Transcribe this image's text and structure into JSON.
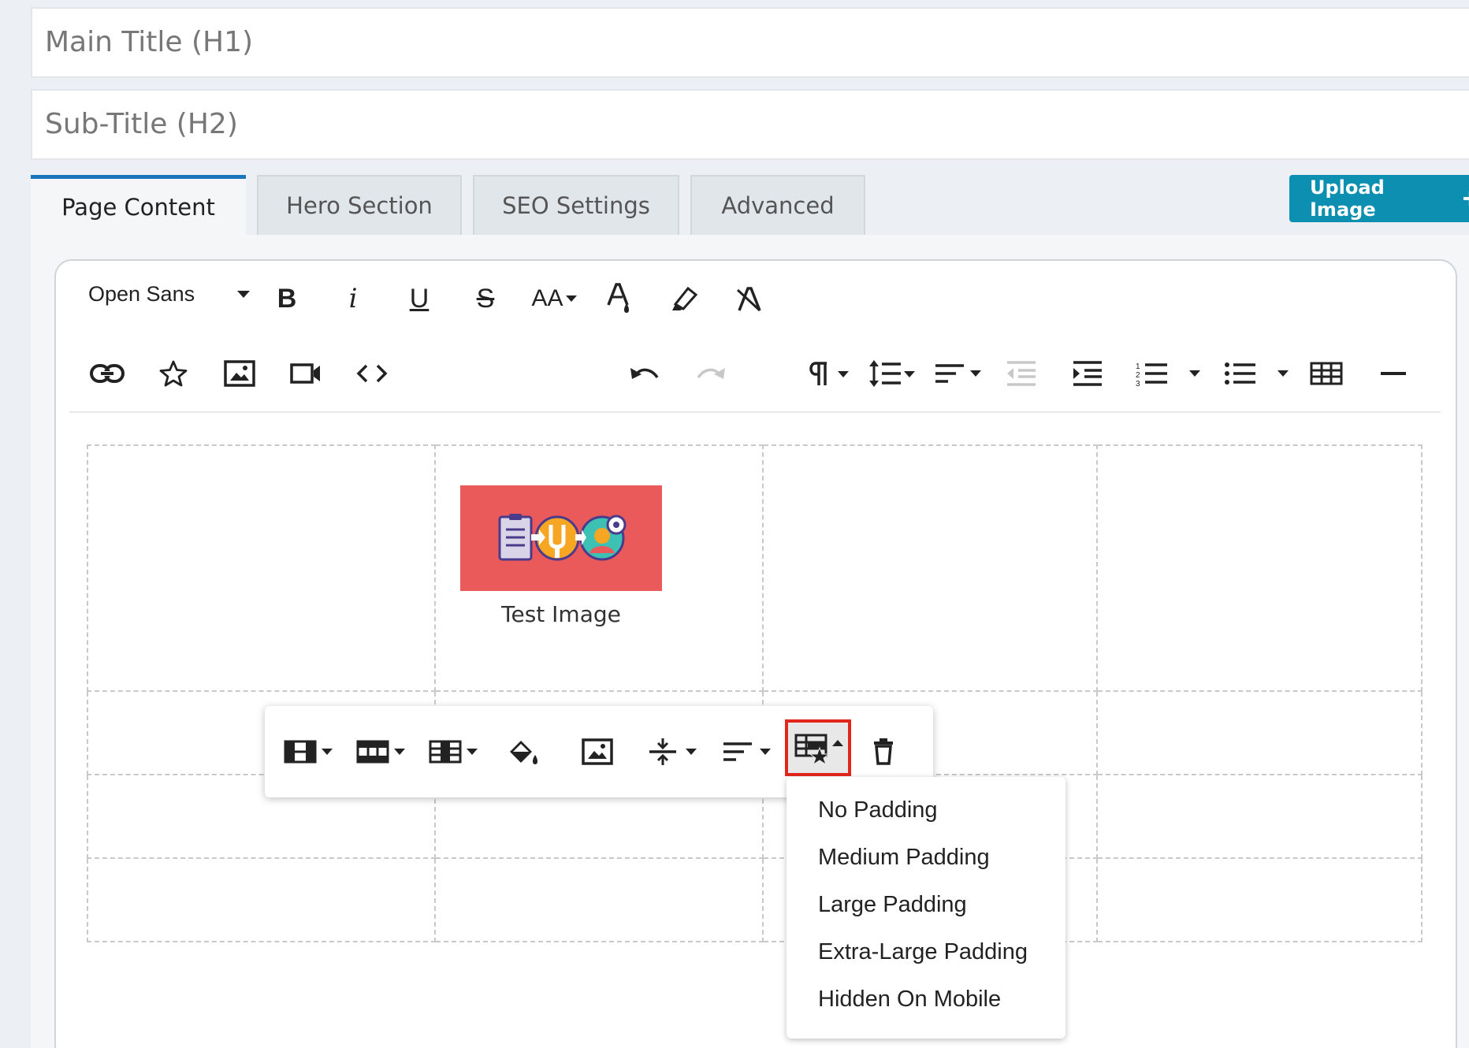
{
  "fields": {
    "main_title_placeholder": "Main Title (H1)",
    "sub_title_placeholder": "Sub-Title (H2)"
  },
  "tabs": [
    {
      "label": "Page Content",
      "active": true
    },
    {
      "label": "Hero Section",
      "active": false
    },
    {
      "label": "SEO Settings",
      "active": false
    },
    {
      "label": "Advanced",
      "active": false
    }
  ],
  "upload_button": {
    "label": "Upload Image",
    "icon": "plus-icon"
  },
  "toolbar": {
    "font_family": "Open Sans",
    "row1_icons": [
      "bold-icon",
      "italic-icon",
      "underline-icon",
      "strikethrough-icon",
      "font-size-icon",
      "text-color-icon",
      "highlight-icon",
      "clear-format-icon"
    ],
    "row2_icons": [
      "link-icon",
      "star-icon",
      "image-icon",
      "video-icon",
      "code-view-icon",
      "undo-icon",
      "redo-icon",
      "paragraph-format-icon",
      "line-height-icon",
      "align-icon",
      "outdent-icon",
      "indent-icon",
      "ordered-list-icon",
      "unordered-list-icon",
      "table-icon",
      "horizontal-line-icon"
    ],
    "bold_label": "B",
    "italic_label": "i",
    "underline_label": "U",
    "strike_label": "S",
    "font_size_label": "AA"
  },
  "content": {
    "image_caption": "Test Image",
    "image_bg_color": "#eb5a5a"
  },
  "table_popup": {
    "icons": [
      "table-header-icon",
      "table-rows-icon",
      "table-columns-icon",
      "cell-background-icon",
      "insert-image-icon",
      "vertical-align-icon",
      "horizontal-align-icon",
      "table-style-icon",
      "remove-table-icon"
    ],
    "active_icon": "table-style-icon"
  },
  "style_dropdown": {
    "options": [
      "No Padding",
      "Medium Padding",
      "Large Padding",
      "Extra-Large Padding",
      "Hidden On Mobile"
    ]
  },
  "colors": {
    "accent": "#1a75bb",
    "upload_button": "#0c8fb1",
    "highlight_border": "#e3261b"
  }
}
